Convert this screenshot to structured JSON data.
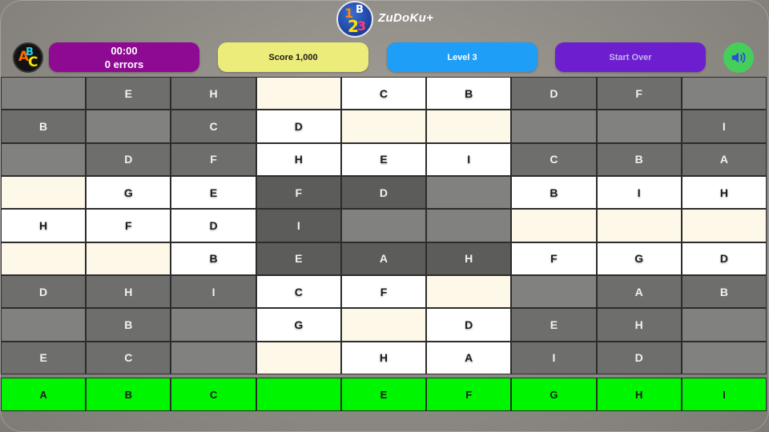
{
  "app": {
    "title": "ZuDoKu+"
  },
  "status": {
    "time": "00:00",
    "errors": "0 errors",
    "score": "Score 1,000",
    "level": "Level 3",
    "restart_label": "Start Over"
  },
  "icons": {
    "logo": "zudoku-123-logo",
    "mode": "abc-mode-icon",
    "sound": "speaker-icon"
  },
  "colors": {
    "timer_pill": "#8e0a93",
    "score_pill": "#ecec7a",
    "level_pill": "#1f9ef7",
    "restart_pill": "#6d1fcf",
    "sound_button": "#45cf5a",
    "picker": "#00f500"
  },
  "board": {
    "rows": [
      [
        "",
        "E",
        "H",
        "",
        "C",
        "B",
        "D",
        "F",
        ""
      ],
      [
        "B",
        "",
        "C",
        "D",
        "",
        "",
        "",
        "",
        "I"
      ],
      [
        "",
        "D",
        "F",
        "H",
        "E",
        "I",
        "C",
        "B",
        "A"
      ],
      [
        "",
        "G",
        "E",
        "F",
        "D",
        "",
        "B",
        "I",
        "H"
      ],
      [
        "H",
        "F",
        "D",
        "I",
        "",
        "",
        "",
        "",
        ""
      ],
      [
        "",
        "",
        "B",
        "E",
        "A",
        "H",
        "F",
        "G",
        "D"
      ],
      [
        "D",
        "H",
        "I",
        "C",
        "F",
        "",
        "",
        "A",
        "B"
      ],
      [
        "",
        "B",
        "",
        "G",
        "",
        "D",
        "E",
        "H",
        ""
      ],
      [
        "E",
        "C",
        "",
        "",
        "H",
        "A",
        "I",
        "D",
        ""
      ]
    ]
  },
  "picker": {
    "letters": [
      "A",
      "B",
      "C",
      "",
      "E",
      "F",
      "G",
      "H",
      "I"
    ]
  }
}
